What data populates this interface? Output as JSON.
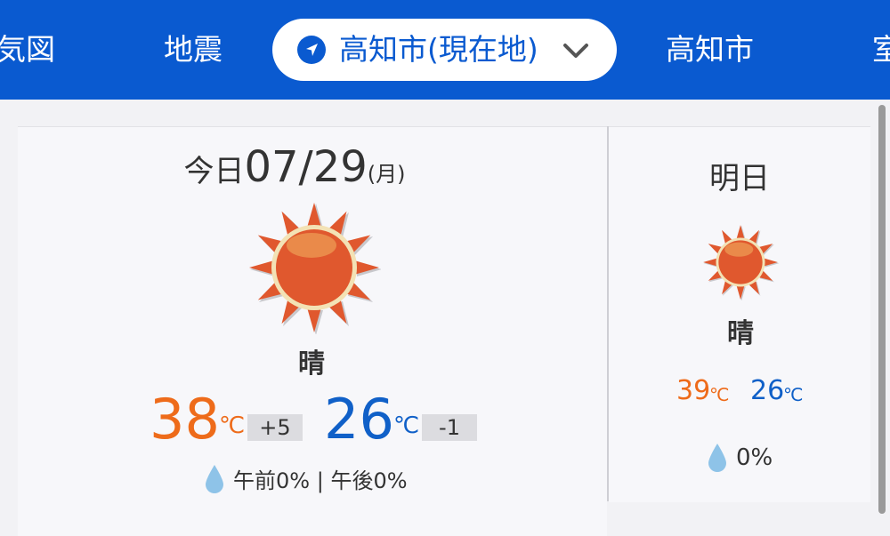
{
  "nav": {
    "items": [
      {
        "label": "気図"
      },
      {
        "label": "地震"
      },
      {
        "label": "高知市(現在地)",
        "selected": true
      },
      {
        "label": "高知市"
      },
      {
        "label": "室"
      }
    ],
    "accent_color": "#0a5ad0"
  },
  "today": {
    "label": "今日",
    "date": "07/29",
    "weekday": "(月)",
    "icon": "sunny-icon",
    "weather": "晴",
    "high": "38",
    "high_unit": "℃",
    "high_diff": "+5",
    "low": "26",
    "low_unit": "℃",
    "low_diff": "-1",
    "rain_am": "午前0%",
    "rain_sep": "|",
    "rain_pm": "午後0%"
  },
  "tomorrow": {
    "label": "明日",
    "icon": "sunny-icon",
    "weather": "晴",
    "high": "39",
    "high_unit": "℃",
    "low": "26",
    "low_unit": "℃",
    "rain": "0%"
  },
  "colors": {
    "high": "#ee6b1a",
    "low": "#1060c8"
  }
}
